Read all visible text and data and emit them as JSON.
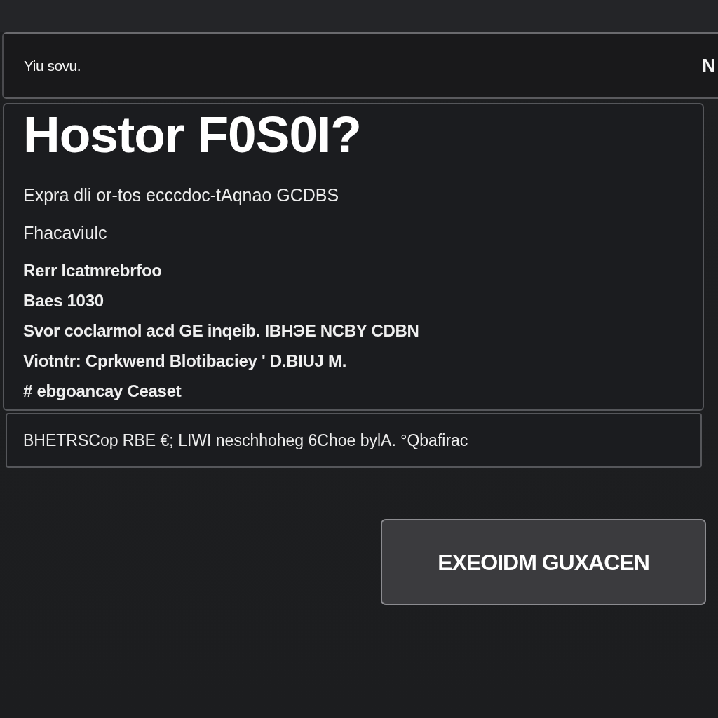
{
  "header": {
    "text": "Yiu sovu.",
    "corner_text": "N"
  },
  "panel": {
    "title": "Hostor F0S0I?",
    "description": [
      "Expra dli or-tos ecccdoc-tAqnao GCDBS",
      "Fhacaviulc"
    ],
    "details": [
      "Rerr lcatmrebrfoo",
      "Baes 1030",
      "Svor coclarmol acd GE inqeib. IBHЭE NCBY CDBN",
      "Viotntr: Cprkwend Blotibaciey ' D.BIUJ M.",
      "# ebgoancay Ceaset"
    ]
  },
  "footer": {
    "text": "BHETRSCop RBE €; LIWI neschhoheg 6Choe bylA. °Qbafirac"
  },
  "button": {
    "label": "EXEOIDM GUXACEN"
  }
}
